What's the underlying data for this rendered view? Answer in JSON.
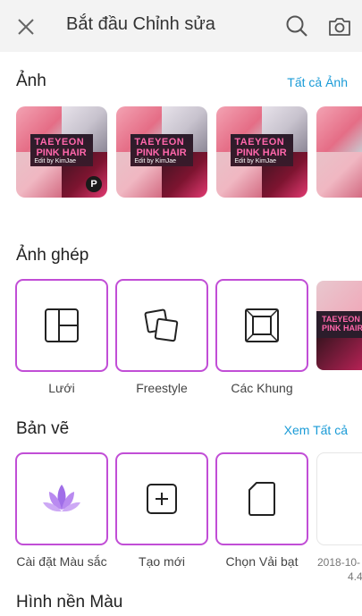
{
  "header": {
    "title": "Bắt đầu Chỉnh sửa"
  },
  "photos_section": {
    "title": "Ảnh",
    "link": "Tất cả Ảnh",
    "banner_line1": "TAEYEON",
    "banner_line2": "PINK HAIR",
    "banner_line3": "Edit by KimJae",
    "badge": "P"
  },
  "collage_section": {
    "title": "Ảnh ghép",
    "items": [
      {
        "label": "Lưới",
        "icon": "grid-icon"
      },
      {
        "label": "Freestyle",
        "icon": "freestyle-icon"
      },
      {
        "label": "Các Khung",
        "icon": "frame-icon"
      }
    ],
    "peek_line1": "TAEYEON",
    "peek_line2": "PINK HAIR"
  },
  "drawing_section": {
    "title": "Bản vẽ",
    "link": "Xem Tất cả",
    "items": [
      {
        "label": "Cài đặt Màu sắc",
        "icon": "lotus-icon"
      },
      {
        "label": "Tạo mới",
        "icon": "add-icon"
      },
      {
        "label": "Chọn Vải bạt",
        "icon": "canvas-icon"
      }
    ],
    "peek_label": "2018-10-",
    "peek_label2": "4.4"
  },
  "background_section": {
    "title": "Hình nền Màu"
  },
  "colors": {
    "accent_purple": "#c14ed6",
    "link_blue": "#1a9bd7",
    "header_bg": "#f3f3f3"
  }
}
